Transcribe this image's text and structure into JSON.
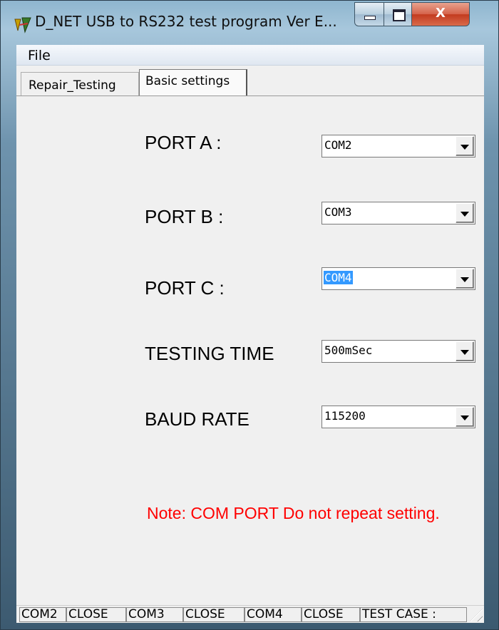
{
  "window": {
    "title": "D_NET USB to RS232 test program Ver E...",
    "controls": {
      "minimize": "minimize",
      "maximize": "maximize",
      "close": "X"
    }
  },
  "menu": {
    "file": "File"
  },
  "tabs": [
    {
      "label": "Repair_Testing",
      "active": false
    },
    {
      "label": "Basic settings",
      "active": true
    }
  ],
  "settings": {
    "port_a": {
      "label": "PORT A :",
      "value": "COM2"
    },
    "port_b": {
      "label": "PORT B :",
      "value": "COM3"
    },
    "port_c": {
      "label": "PORT C :",
      "value": "COM4"
    },
    "testing_time": {
      "label": "TESTING TIME",
      "value": "500mSec"
    },
    "baud_rate": {
      "label": "BAUD RATE",
      "value": "115200"
    }
  },
  "note": "Note: COM PORT Do not repeat setting.",
  "note_color": "#ff0000",
  "status": {
    "cells": [
      "COM2",
      "CLOSE",
      "COM3",
      "CLOSE",
      "COM4",
      "CLOSE",
      " TEST CASE :",
      ""
    ]
  }
}
